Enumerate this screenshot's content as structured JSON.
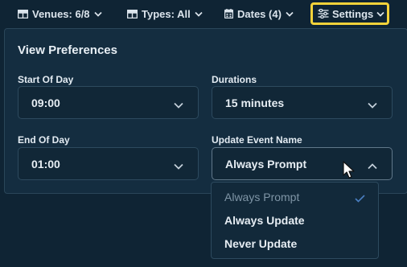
{
  "toolbar": {
    "venues_label": "Venues: 6/8",
    "types_label": "Types: All",
    "dates_label": "Dates (4)",
    "settings_label": "Settings",
    "highlight_color": "#f3d23a"
  },
  "panel": {
    "title": "View Preferences",
    "start_of_day": {
      "label": "Start Of Day",
      "value": "09:00"
    },
    "durations": {
      "label": "Durations",
      "value": "15 minutes"
    },
    "end_of_day": {
      "label": "End Of Day",
      "value": "01:00"
    },
    "update_event_name": {
      "label": "Update Event Name",
      "value": "Always Prompt"
    }
  },
  "dropdown": {
    "options": [
      {
        "label": "Always Prompt",
        "selected": true
      },
      {
        "label": "Always Update",
        "selected": false
      },
      {
        "label": "Never Update",
        "selected": false
      }
    ],
    "check_color": "#4a7fc1"
  }
}
